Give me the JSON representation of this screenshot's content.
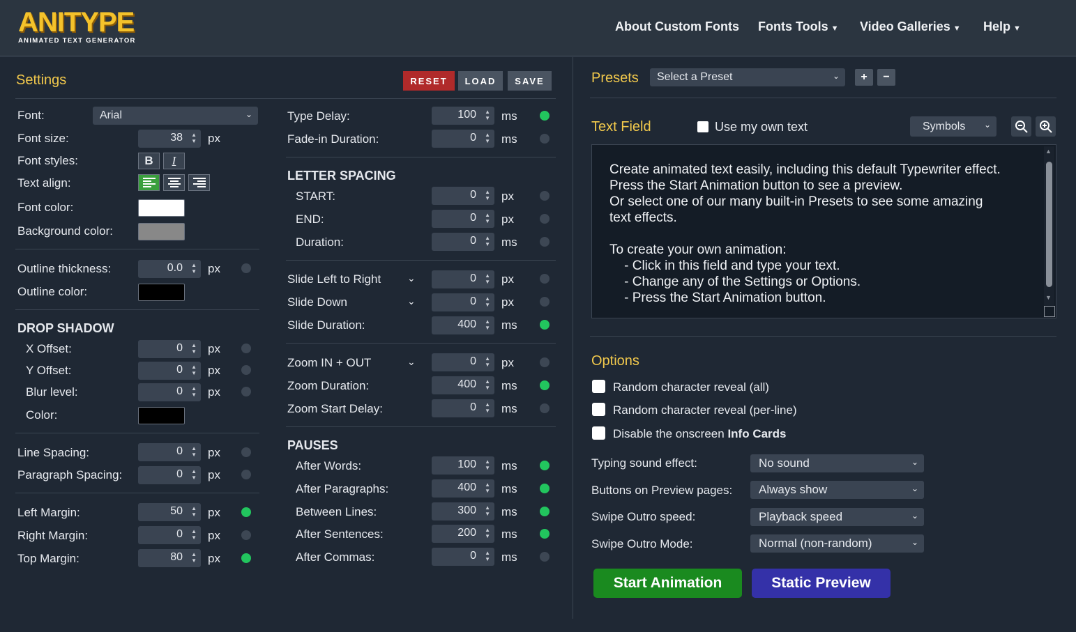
{
  "header": {
    "logo_word": "ANITYPE",
    "logo_sub": "ANIMATED TEXT GENERATOR",
    "nav": [
      {
        "label": "About Custom Fonts",
        "caret": ""
      },
      {
        "label": "Fonts Tools",
        "caret": "▼"
      },
      {
        "label": "Video Galleries",
        "caret": "▼"
      },
      {
        "label": "Help",
        "caret": "▼"
      }
    ]
  },
  "settings": {
    "title": "Settings",
    "buttons": {
      "reset": "RESET",
      "load": "LOAD",
      "save": "SAVE"
    },
    "font": {
      "label": "Font:",
      "value": "Arial"
    },
    "font_size": {
      "label": "Font size:",
      "value": "38",
      "unit": "px"
    },
    "font_styles": {
      "label": "Font styles:",
      "bold": "B",
      "italic": "I"
    },
    "text_align": {
      "label": "Text align:"
    },
    "font_color": {
      "label": "Font color:",
      "color": "#ffffff"
    },
    "bg_color": {
      "label": "Background color:",
      "color": "#888888"
    },
    "outline_thickness": {
      "label": "Outline thickness:",
      "value": "0.0",
      "unit": "px"
    },
    "outline_color": {
      "label": "Outline color:",
      "color": "#000000"
    },
    "drop_shadow": {
      "heading": "DROP SHADOW",
      "x": {
        "label": "X Offset:",
        "value": "0",
        "unit": "px"
      },
      "y": {
        "label": "Y Offset:",
        "value": "0",
        "unit": "px"
      },
      "blur": {
        "label": "Blur level:",
        "value": "0",
        "unit": "px"
      },
      "color": {
        "label": "Color:",
        "color": "#000000"
      }
    },
    "line_spacing": {
      "label": "Line Spacing:",
      "value": "0",
      "unit": "px"
    },
    "paragraph_spacing": {
      "label": "Paragraph Spacing:",
      "value": "0",
      "unit": "px"
    },
    "left_margin": {
      "label": "Left Margin:",
      "value": "50",
      "unit": "px"
    },
    "right_margin": {
      "label": "Right Margin:",
      "value": "0",
      "unit": "px"
    },
    "top_margin": {
      "label": "Top Margin:",
      "value": "80",
      "unit": "px"
    }
  },
  "timing": {
    "type_delay": {
      "label": "Type Delay:",
      "value": "100",
      "unit": "ms"
    },
    "fade_in": {
      "label": "Fade-in Duration:",
      "value": "0",
      "unit": "ms"
    },
    "letter_spacing": {
      "heading": "LETTER SPACING",
      "start": {
        "label": "START:",
        "value": "0",
        "unit": "px"
      },
      "end": {
        "label": "END:",
        "value": "0",
        "unit": "px"
      },
      "duration": {
        "label": "Duration:",
        "value": "0",
        "unit": "ms"
      }
    },
    "slide_lr": {
      "label": "Slide Left to Right",
      "value": "0",
      "unit": "px"
    },
    "slide_down": {
      "label": "Slide Down",
      "value": "0",
      "unit": "px"
    },
    "slide_duration": {
      "label": "Slide Duration:",
      "value": "400",
      "unit": "ms"
    },
    "zoom": {
      "label": "Zoom IN + OUT",
      "value": "0",
      "unit": "px"
    },
    "zoom_duration": {
      "label": "Zoom Duration:",
      "value": "400",
      "unit": "ms"
    },
    "zoom_delay": {
      "label": "Zoom Start Delay:",
      "value": "0",
      "unit": "ms"
    },
    "pauses": {
      "heading": "PAUSES",
      "words": {
        "label": "After Words:",
        "value": "100",
        "unit": "ms"
      },
      "paragraphs": {
        "label": "After Paragraphs:",
        "value": "400",
        "unit": "ms"
      },
      "lines": {
        "label": "Between Lines:",
        "value": "300",
        "unit": "ms"
      },
      "sentences": {
        "label": "After Sentences:",
        "value": "200",
        "unit": "ms"
      },
      "commas": {
        "label": "After Commas:",
        "value": "0",
        "unit": "ms"
      }
    }
  },
  "presets": {
    "title": "Presets",
    "select": "Select a Preset",
    "add": "+",
    "remove": "−"
  },
  "text_field": {
    "title": "Text Field",
    "own_text": "Use my own text",
    "symbols": "Symbols",
    "content": "Create animated text easily, including this default Typewriter effect.\nPress the Start Animation button to see a preview.\nOr select one of our many built-in Presets to see some amazing\ntext effects.\n\nTo create your own animation:\n    - Click in this field and type your text.\n    - Change any of the Settings or Options.\n    - Press the Start Animation button."
  },
  "options": {
    "title": "Options",
    "rand_all": "Random character reveal (all)",
    "rand_line": "Random character reveal (per-line)",
    "disable_prefix": "Disable the onscreen ",
    "disable_bold": "Info Cards",
    "typing_sound": {
      "label": "Typing sound effect:",
      "value": "No sound"
    },
    "buttons_preview": {
      "label": "Buttons on Preview pages:",
      "value": "Always show"
    },
    "swipe_speed": {
      "label": "Swipe Outro speed:",
      "value": "Playback speed"
    },
    "swipe_mode": {
      "label": "Swipe Outro Mode:",
      "value": "Normal (non-random)"
    }
  },
  "actions": {
    "start": "Start Animation",
    "static": "Static Preview"
  },
  "colors": {
    "accent": "#f2c94c",
    "green": "#22c55e",
    "reset": "#b02a2a",
    "start": "#1a8a1f",
    "static": "#3431a8"
  }
}
